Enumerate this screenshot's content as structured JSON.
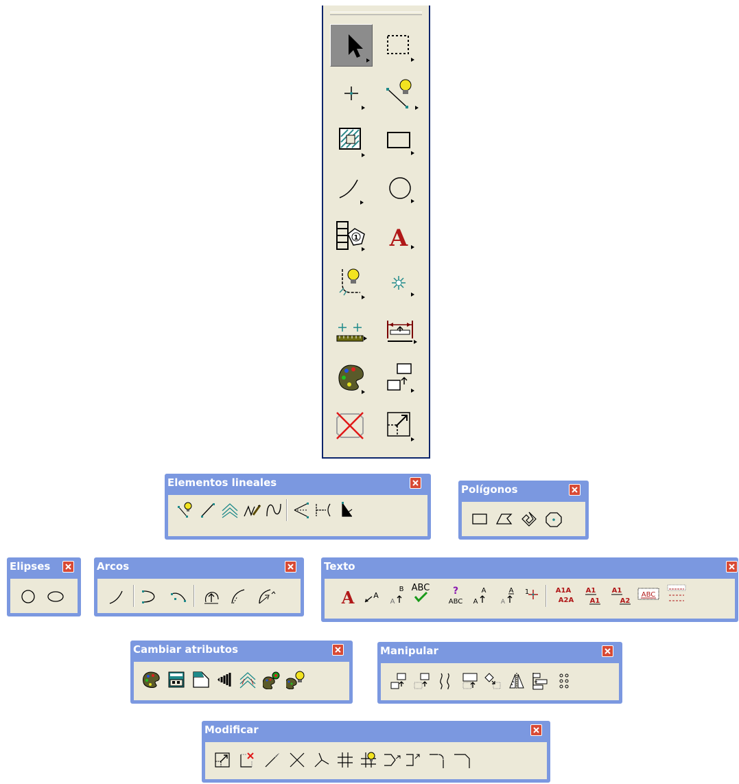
{
  "toolbox": {
    "tools": [
      {
        "name": "select-arrow-icon"
      },
      {
        "name": "selection-fence-icon"
      },
      {
        "name": "point-icon"
      },
      {
        "name": "smart-line-icon"
      },
      {
        "name": "hatch-pattern-icon"
      },
      {
        "name": "rectangle-icon"
      },
      {
        "name": "arc-icon"
      },
      {
        "name": "circle-icon"
      },
      {
        "name": "cell-tag-icon"
      },
      {
        "name": "text-icon"
      },
      {
        "name": "smart-fillet-icon"
      },
      {
        "name": "snap-point-icon"
      },
      {
        "name": "measure-distance-icon"
      },
      {
        "name": "dimension-icon"
      },
      {
        "name": "palette-attributes-icon"
      },
      {
        "name": "copy-move-icon"
      },
      {
        "name": "delete-icon"
      },
      {
        "name": "extend-fit-icon"
      }
    ]
  },
  "palettes": {
    "lineales": {
      "title": "Elementos lineales"
    },
    "poligonos": {
      "title": "Polígonos"
    },
    "elipses": {
      "title": "Elipses"
    },
    "arcos": {
      "title": "Arcos"
    },
    "texto": {
      "title": "Texto",
      "labels": {
        "abc": "ABC",
        "q": "?",
        "a": "A",
        "b": "B",
        "one": "1",
        "a1a": "A1A",
        "a2a": "A2A",
        "a1": "A1",
        "a2": "A2"
      }
    },
    "atributos": {
      "title": "Cambiar atributos"
    },
    "manipular": {
      "title": "Manipular"
    },
    "modificar": {
      "title": "Modificar"
    }
  },
  "colors": {
    "titlebar": "#7b98e0",
    "window_bg": "#ece9d8",
    "close_button": "#d84a35",
    "text_red": "#b01818",
    "teal": "#2e8b8b",
    "bulb": "#f2e320"
  }
}
